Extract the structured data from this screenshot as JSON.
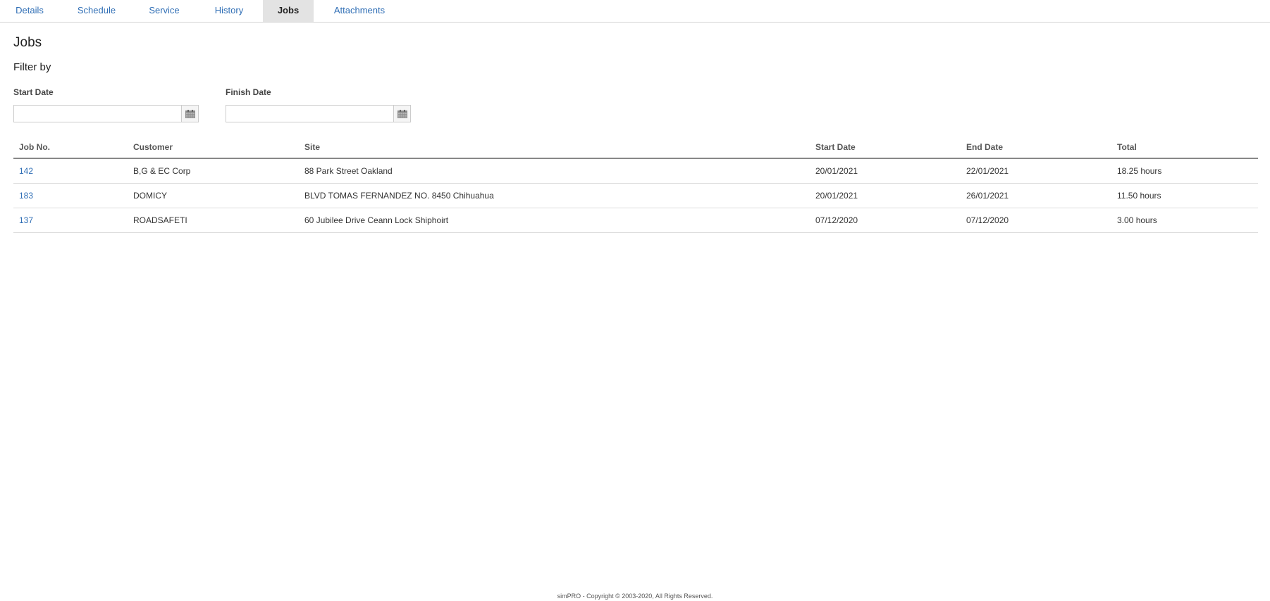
{
  "tabs": [
    {
      "label": "Details"
    },
    {
      "label": "Schedule"
    },
    {
      "label": "Service"
    },
    {
      "label": "History"
    },
    {
      "label": "Jobs",
      "active": true
    },
    {
      "label": "Attachments"
    }
  ],
  "page": {
    "title": "Jobs",
    "filter_title": "Filter by"
  },
  "filters": {
    "start_date": {
      "label": "Start Date",
      "value": "",
      "icon": "calendar-icon"
    },
    "finish_date": {
      "label": "Finish Date",
      "value": "",
      "icon": "calendar-icon"
    }
  },
  "table": {
    "columns": [
      "Job No.",
      "Customer",
      "Site",
      "Start Date",
      "End Date",
      "Total"
    ],
    "rows": [
      {
        "job_no": "142",
        "customer": "B,G & EC Corp",
        "site": "88 Park Street Oakland",
        "start_date": "20/01/2021",
        "end_date": "22/01/2021",
        "total": "18.25 hours"
      },
      {
        "job_no": "183",
        "customer": "DOMICY",
        "site": "BLVD TOMAS FERNANDEZ NO. 8450 Chihuahua",
        "start_date": "20/01/2021",
        "end_date": "26/01/2021",
        "total": "11.50 hours"
      },
      {
        "job_no": "137",
        "customer": "ROADSAFETI",
        "site": "60 Jubilee Drive Ceann Lock Shiphoirt",
        "start_date": "07/12/2020",
        "end_date": "07/12/2020",
        "total": "3.00 hours"
      }
    ]
  },
  "footer": {
    "text": "simPRO - Copyright © 2003-2020, All Rights Reserved."
  },
  "colors": {
    "link": "#2f6eb5",
    "active_tab_bg": "#e3e3e3"
  }
}
